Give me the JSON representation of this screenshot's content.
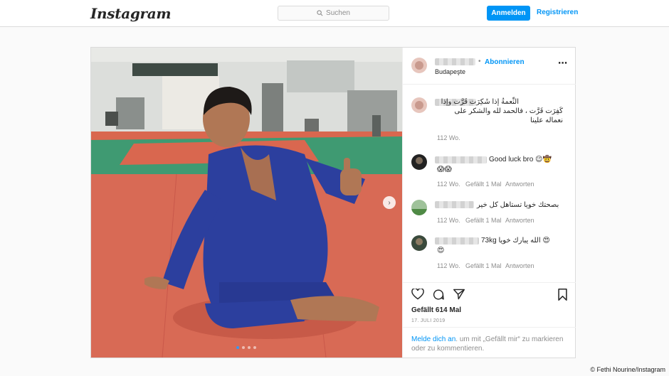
{
  "header": {
    "logo": "Instagram",
    "search_placeholder": "Suchen",
    "login_label": "Anmelden",
    "register_label": "Registrieren"
  },
  "post": {
    "follow_label": "Abonnieren",
    "location": "Budapeşte",
    "caption": "النِّعمةُ إذا شَكِرَت قَرَّت وإذا كَفِرَت فَرَّت ، فالحمد لله والشكر على نعماله علينا",
    "caption_time": "112 Wo.",
    "carousel": {
      "total": 4,
      "current": 1
    },
    "likes": "Gefällt 614 Mal",
    "date": "17. JULI 2019",
    "login_prompt_link": "Melde dich an",
    "login_prompt_text": ". um mit „Gefällt mir“ zu markieren oder zu kommentieren."
  },
  "comments": [
    {
      "text": "Good luck bro 😉🤠",
      "emoji_line": "😱😱",
      "time": "112 Wo.",
      "likes": "Gefällt 1 Mal",
      "reply": "Antworten"
    },
    {
      "text": "بصحتك خويا تستاهل كل خير",
      "time": "112 Wo.",
      "likes": "Gefällt 1 Mal",
      "reply": "Antworten"
    },
    {
      "text": "73kg الله يبارك خويا 😍",
      "emoji_line": "😍",
      "time": "112 Wo.",
      "likes": "Gefällt 1 Mal",
      "reply": "Antworten"
    }
  ],
  "icons": [
    "search-icon",
    "more-icon",
    "chevron-right-icon",
    "heart-icon",
    "comment-icon",
    "share-icon",
    "bookmark-icon"
  ],
  "colors": {
    "accent": "#0095f6",
    "mat_red": "#d9674f",
    "mat_green": "#3f9a72",
    "gi_blue": "#2c3f9e"
  },
  "credit": "© Fethi Nourine/Instagram"
}
